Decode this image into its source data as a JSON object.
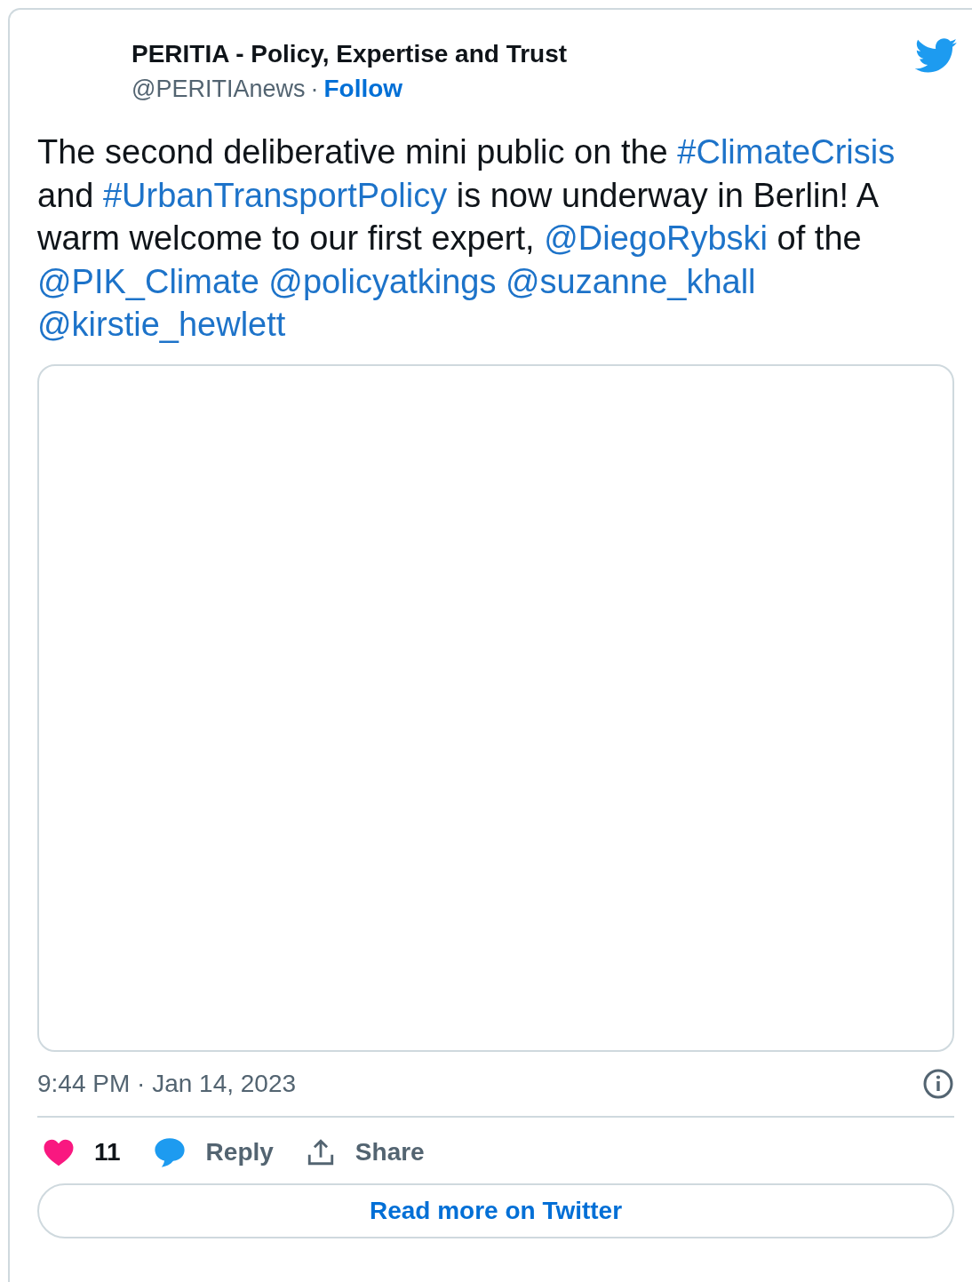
{
  "author": {
    "name": "PERITIA - Policy, Expertise and Trust",
    "handle": "@PERITIAnews",
    "separator": "·",
    "follow": "Follow"
  },
  "tweet": {
    "parts": [
      {
        "kind": "text",
        "text": "The second deliberative mini public on the "
      },
      {
        "kind": "link",
        "text": "#ClimateCrisis"
      },
      {
        "kind": "text",
        "text": " and "
      },
      {
        "kind": "link",
        "text": "#UrbanTransportPolicy"
      },
      {
        "kind": "text",
        "text": " is now underway in Berlin! A warm welcome to our first expert, "
      },
      {
        "kind": "link",
        "text": "@DiegoRybski"
      },
      {
        "kind": "text",
        "text": " of the "
      },
      {
        "kind": "link",
        "text": "@PIK_Climate"
      },
      {
        "kind": "link",
        "text": "@policyatkings"
      },
      {
        "kind": "link",
        "text": "@suzanne_khall"
      },
      {
        "kind": "link",
        "text": "@kirstie_hewlett"
      }
    ]
  },
  "timestamp": "9:44 PM · Jan 14, 2023",
  "actions": [
    {
      "kind": "like",
      "label": "11"
    },
    {
      "kind": "reply",
      "label": "Reply"
    },
    {
      "kind": "share",
      "label": "Share"
    }
  ],
  "read_more": "Read more on Twitter"
}
